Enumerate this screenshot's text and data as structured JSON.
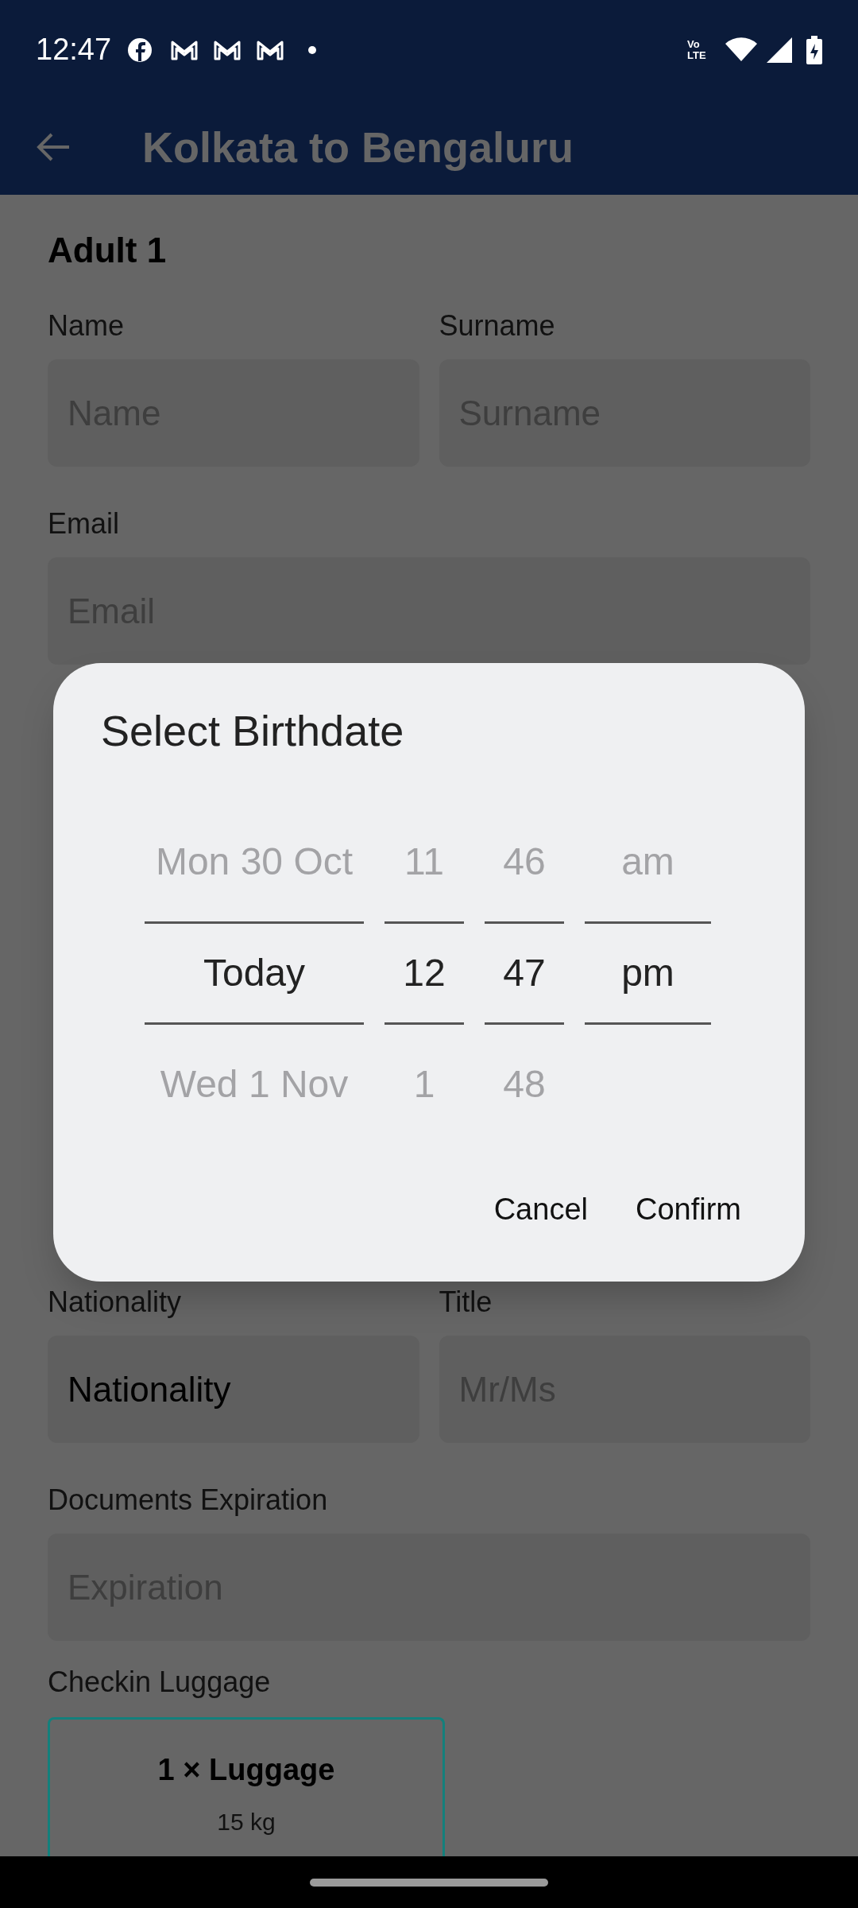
{
  "status_bar": {
    "time": "12:47",
    "network_label": "Vo LTE"
  },
  "app_bar": {
    "title": "Kolkata to Bengaluru"
  },
  "form": {
    "heading": "Adult 1",
    "rows": [
      [
        {
          "label": "Name",
          "placeholder": "Name"
        },
        {
          "label": "Surname",
          "placeholder": "Surname"
        }
      ],
      [
        {
          "label": "Email",
          "placeholder": "Email"
        }
      ]
    ],
    "lower_rows": [
      [
        {
          "label": "Nationality",
          "value": "Nationality"
        },
        {
          "label": "Title",
          "placeholder": "Mr/Ms"
        }
      ],
      [
        {
          "label": "Documents Expiration",
          "placeholder": "Expiration"
        }
      ]
    ],
    "luggage": {
      "label": "Checkin Luggage",
      "option": {
        "title": "1 × Luggage",
        "weight": "15 kg",
        "selected": true
      }
    }
  },
  "dialog": {
    "title": "Select Birthdate",
    "columns": [
      {
        "items": [
          {
            "text": "Mon 30 Oct",
            "selected": false
          },
          {
            "text": "Today",
            "selected": true
          },
          {
            "text": "Wed 1 Nov",
            "selected": false
          }
        ]
      },
      {
        "items": [
          {
            "text": "11",
            "selected": false
          },
          {
            "text": "12",
            "selected": true
          },
          {
            "text": "1",
            "selected": false
          }
        ]
      },
      {
        "items": [
          {
            "text": "46",
            "selected": false
          },
          {
            "text": "47",
            "selected": true
          },
          {
            "text": "48",
            "selected": false
          }
        ]
      },
      {
        "items": [
          {
            "text": "am",
            "selected": false
          },
          {
            "text": "pm",
            "selected": true
          }
        ]
      }
    ],
    "buttons": [
      "Cancel",
      "Confirm"
    ]
  }
}
